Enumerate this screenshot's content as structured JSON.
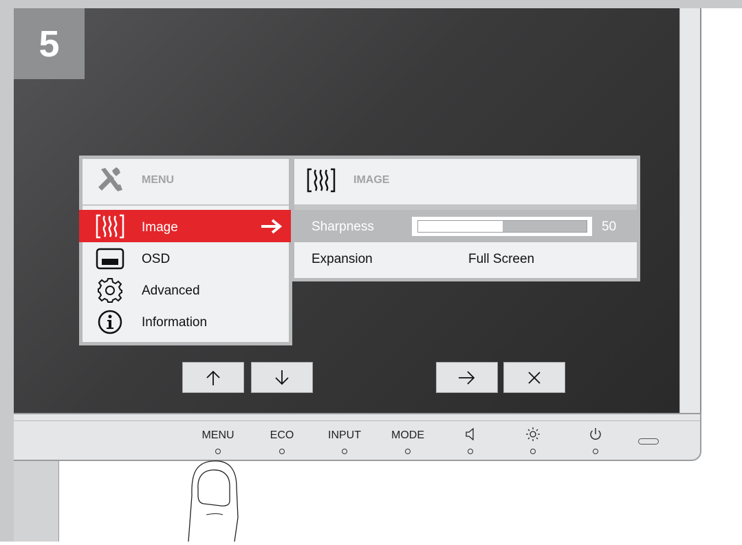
{
  "step_number": "5",
  "osd": {
    "menu_title": "MENU",
    "submenu_title": "IMAGE",
    "menu_items": [
      {
        "label": "Image",
        "icon": "image-wave-icon",
        "selected": true
      },
      {
        "label": "OSD",
        "icon": "osd-screen-icon",
        "selected": false
      },
      {
        "label": "Advanced",
        "icon": "gear-icon",
        "selected": false
      },
      {
        "label": "Information",
        "icon": "info-icon",
        "selected": false
      }
    ],
    "settings": [
      {
        "label": "Sharpness",
        "value": "50",
        "level": 0.5
      },
      {
        "label": "Expansion",
        "value": "Full Screen"
      }
    ]
  },
  "nav_buttons": [
    "up-arrow",
    "down-arrow",
    "right-arrow",
    "close"
  ],
  "bezel": {
    "buttons": [
      "MENU",
      "ECO",
      "INPUT",
      "MODE"
    ],
    "icon_buttons": [
      "volume-icon",
      "brightness-icon",
      "power-icon"
    ]
  },
  "colors": {
    "selected_row": "#e4252a",
    "osd_background": "#f0f1f2",
    "osd_border": "#b9babc",
    "step_badge": "#8f9092"
  }
}
